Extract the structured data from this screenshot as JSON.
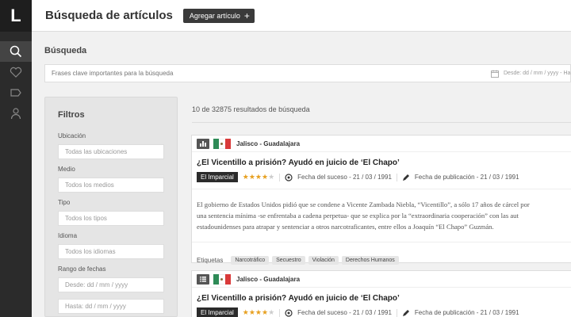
{
  "rail": {
    "logo": "L"
  },
  "header": {
    "title": "Búsqueda de artículos",
    "add_button": "Agregar artículo"
  },
  "search": {
    "label": "Búsqueda",
    "placeholder": "Frases clave importantes para la búsqueda",
    "date_placeholder": "Desde: dd / mm / yyyy - Ha"
  },
  "filters": {
    "title": "Filtros",
    "fields": [
      {
        "label": "Ubicación",
        "placeholder": "Todas las ubicaciones"
      },
      {
        "label": "Medio",
        "placeholder": "Todos los medios"
      },
      {
        "label": "Tipo",
        "placeholder": "Todos los tipos"
      },
      {
        "label": "Idioma",
        "placeholder": "Todos los idiomas"
      },
      {
        "label": "Rango de fechas",
        "placeholder": "Desde: dd / mm / yyyy"
      }
    ],
    "date_to_placeholder": "Hasta: dd / mm / yyyy"
  },
  "results": {
    "count_text": "10 de 32875 resultados de búsqueda",
    "cards": [
      {
        "location": "Jalisco - Guadalajara",
        "title": "¿El Vicentillo a prisión? Ayudó en juicio de ‘El Chapo’",
        "source": "El Imparcial",
        "rating": 4,
        "event_date": "Fecha del suceso - 21 / 03 / 1991",
        "pub_date": "Fecha de publicación - 21 / 03 / 1991",
        "body": [
          "El gobierno de Estados Unidos pidió que se condene a Vicente Zambada Niebla, “Vicentillo”, a sólo 17 años de cárcel por",
          "una sentencia mínima -se enfrentaba a cadena perpetua- que se explica por la “extraordinaria cooperación” con las aut",
          "estadounidenses para atrapar y sentenciar a otros narcotraficantes, entre ellos a Joaquín “El Chapo” Guzmán."
        ],
        "tags_label": "Etiquetas",
        "tags": [
          "Narcotráfico",
          "Secuestro",
          "Violación",
          "Derechos Humanos"
        ]
      },
      {
        "location": "Jalisco - Guadalajara",
        "title": "¿El Vicentillo a prisión? Ayudó en juicio de ‘El Chapo’",
        "source": "El Imparcial",
        "rating": 4,
        "event_date": "Fecha del suceso - 21 / 03 / 1991",
        "pub_date": "Fecha de publicación - 21 / 03 / 1991"
      }
    ]
  },
  "colors": {
    "rail": "#2b2b2b",
    "accent_star": "#e7a020"
  }
}
